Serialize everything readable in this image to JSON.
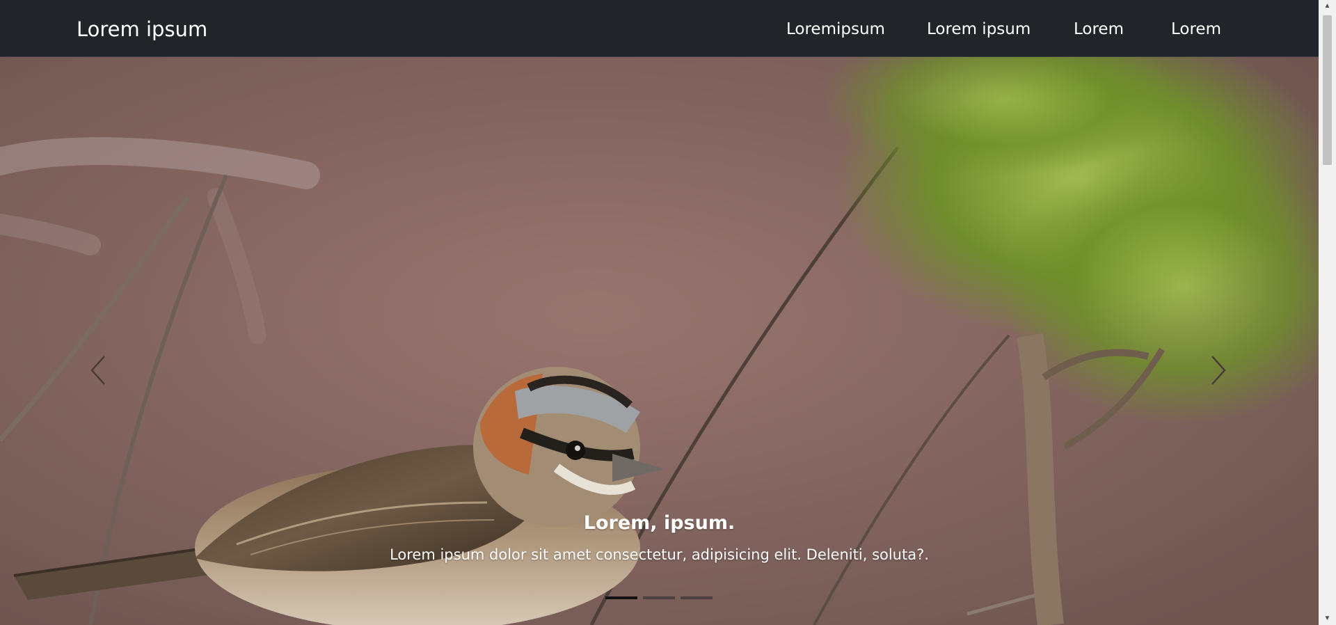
{
  "navbar": {
    "brand": "Lorem ipsum",
    "links": [
      "Loremipsum",
      "Lorem ipsum",
      "Lorem",
      "Lorem"
    ]
  },
  "carousel": {
    "caption_title": "Lorem, ipsum.",
    "caption_text": "Lorem ipsum dolor sit amet consectetur, adipisicing elit. Deleniti, soluta?.",
    "slide_count": 3,
    "active_slide": 1,
    "prev_icon": "chevron-left-icon",
    "next_icon": "chevron-right-icon"
  },
  "colors": {
    "navbar_bg": "#212529",
    "nav_text": "#ffffff",
    "indicator_active": "#111111"
  }
}
